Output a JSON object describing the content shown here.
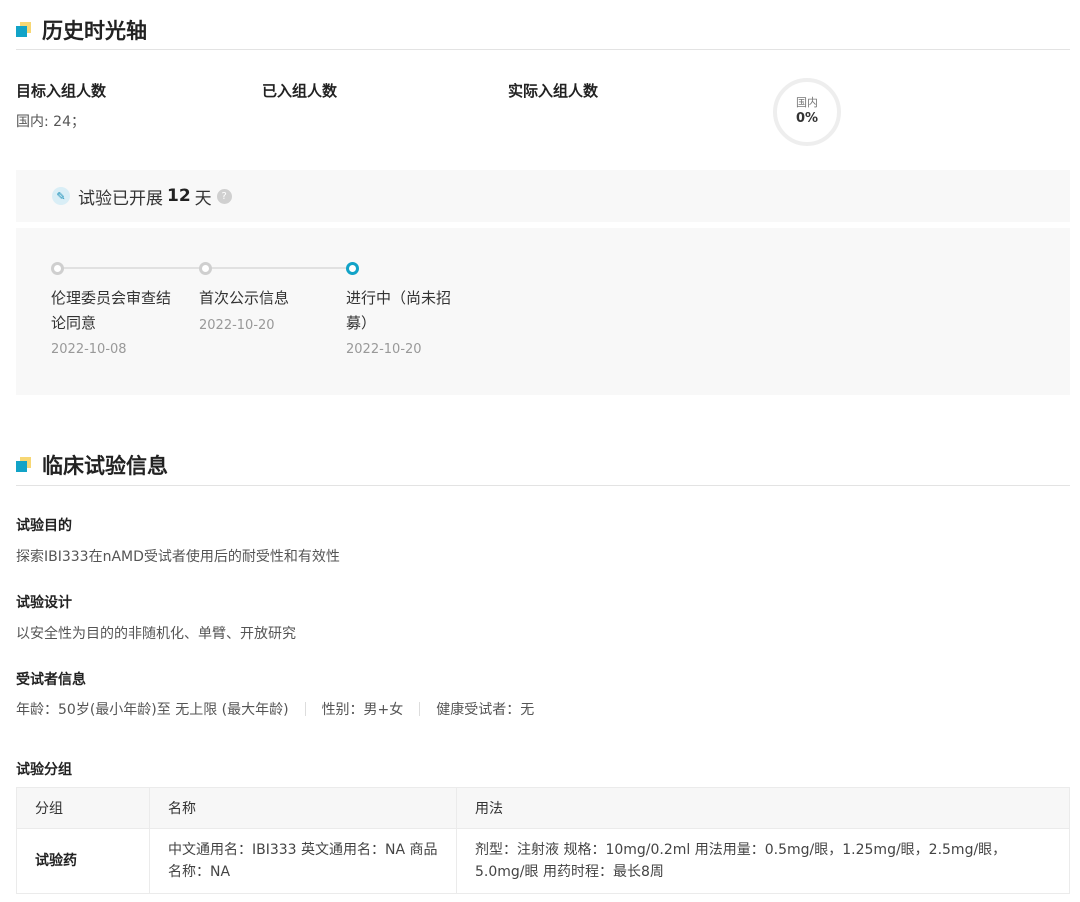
{
  "timeline_section": {
    "title": "历史时光轴",
    "stats": {
      "target_label": "目标入组人数",
      "target_value": "国内: 24；",
      "enrolled_label": "已入组人数",
      "actual_label": "实际入组人数"
    },
    "progress": {
      "label": "国内",
      "percent_text": "0%",
      "percent": 0
    },
    "started": {
      "prefix": "试验已开展",
      "days": "12",
      "suffix": "天"
    },
    "events": [
      {
        "title": "伦理委员会审查结论同意",
        "date": "2022-10-08",
        "active": false
      },
      {
        "title": "首次公示信息",
        "date": "2022-10-20",
        "active": false
      },
      {
        "title": "进行中（尚未招募）",
        "date": "2022-10-20",
        "active": true
      }
    ]
  },
  "clinical_section": {
    "title": "临床试验信息",
    "purpose_label": "试验目的",
    "purpose_value": "探索IBI333在nAMD受试者使用后的耐受性和有效性",
    "design_label": "试验设计",
    "design_value": "以安全性为目的的非随机化、单臂、开放研究",
    "subject_label": "受试者信息",
    "subject_age": "年龄：50岁(最小年龄)至 无上限 (最大年龄)",
    "subject_gender": "性别：男+女",
    "subject_healthy": "健康受试者：无",
    "groups_label": "试验分组",
    "table": {
      "headers": [
        "分组",
        "名称",
        "用法"
      ],
      "rows": [
        {
          "group": "试验药",
          "name": "中文通用名：IBI333 英文通用名：NA 商品名称：NA",
          "usage": "剂型：注射液 规格：10mg/0.2ml 用法用量：0.5mg/眼，1.25mg/眼，2.5mg/眼，5.0mg/眼 用药时程：最长8周"
        }
      ]
    }
  },
  "icons": {
    "started_icon": "pen-icon",
    "help_icon": "question-icon"
  },
  "colors": {
    "accent": "#12a3c7",
    "accent_yellow": "#f7d774"
  }
}
